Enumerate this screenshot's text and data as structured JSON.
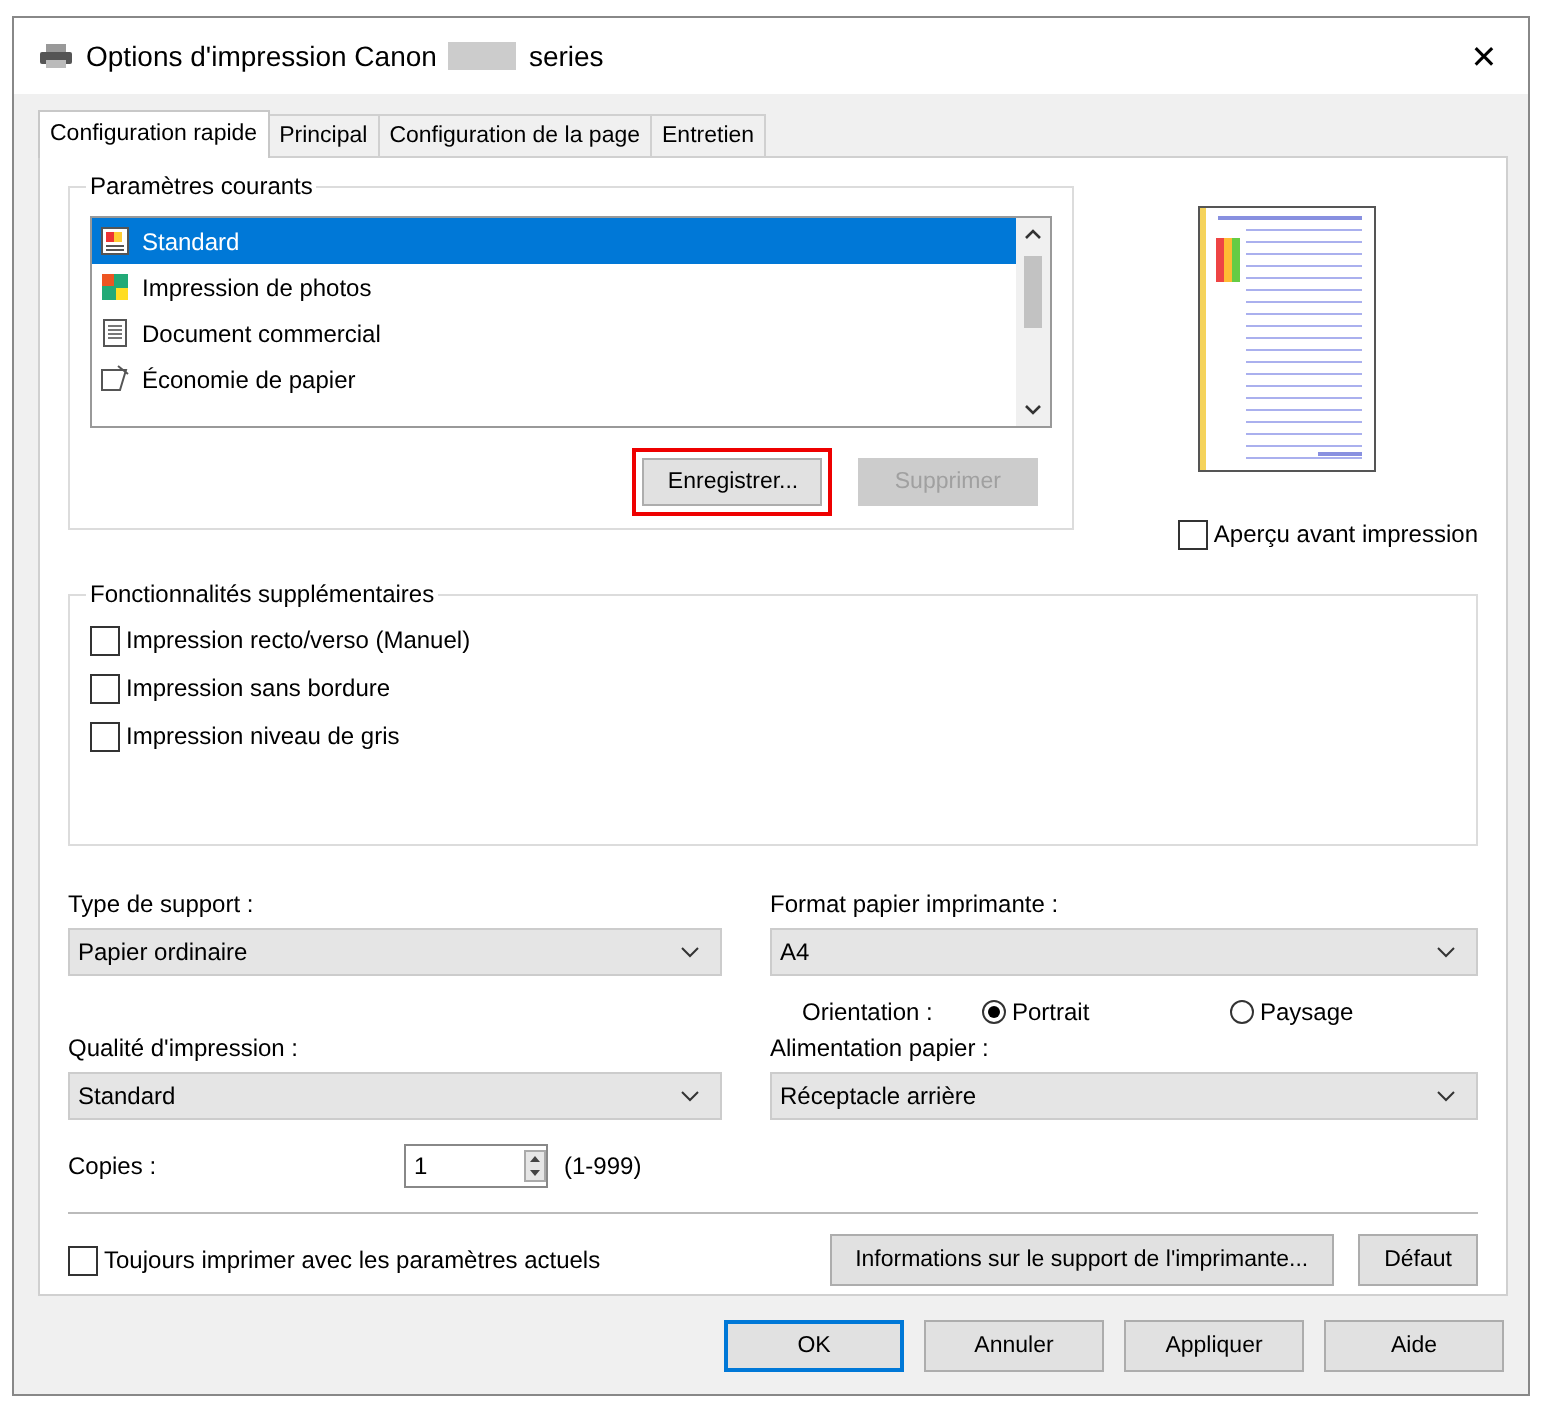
{
  "window": {
    "title": "Options d'impression Canon",
    "title_suffix": "series",
    "close": "✕"
  },
  "tabs": [
    {
      "label": "Configuration rapide",
      "selected": true
    },
    {
      "label": "Principal",
      "selected": false
    },
    {
      "label": "Configuration de la page",
      "selected": false
    },
    {
      "label": "Entretien",
      "selected": false
    }
  ],
  "current_settings": {
    "title": "Paramètres courants",
    "items": [
      {
        "label": "Standard",
        "selected": true,
        "kind": "standard"
      },
      {
        "label": "Impression de photos",
        "selected": false,
        "kind": "photo"
      },
      {
        "label": "Document commercial",
        "selected": false,
        "kind": "document"
      },
      {
        "label": "Économie de papier",
        "selected": false,
        "kind": "paper"
      }
    ],
    "buttons": [
      {
        "label": "Enregistrer...",
        "disabled": false,
        "highlighted": true
      },
      {
        "label": "Supprimer",
        "disabled": true,
        "highlighted": false
      }
    ]
  },
  "preview": {
    "checkbox": {
      "label": "Aperçu avant impression",
      "checked": false
    }
  },
  "additional_features": {
    "title": "Fonctionnalités supplémentaires",
    "options": [
      {
        "label": "Impression recto/verso (Manuel)",
        "checked": false
      },
      {
        "label": "Impression sans bordure",
        "checked": false
      },
      {
        "label": "Impression niveau de gris",
        "checked": false
      }
    ]
  },
  "media_type": {
    "label": "Type de support :",
    "value": "Papier ordinaire"
  },
  "page_size": {
    "label": "Format papier imprimante :",
    "value": "A4"
  },
  "orientation": {
    "label": "Orientation :",
    "options": [
      {
        "label": "Portrait",
        "selected": true
      },
      {
        "label": "Paysage",
        "selected": false
      }
    ]
  },
  "print_quality": {
    "label": "Qualité d'impression :",
    "value": "Standard"
  },
  "paper_source": {
    "label": "Alimentation papier :",
    "value": "Réceptacle arrière"
  },
  "copies": {
    "label": "Copies :",
    "value": "1",
    "range": "(1-999)"
  },
  "always_print": {
    "label": "Toujours imprimer avec les paramètres actuels",
    "checked": false
  },
  "panel_buttons": [
    "Informations sur le support de l'imprimante...",
    "Défaut"
  ],
  "dialog_buttons": [
    {
      "label": "OK",
      "default": true
    },
    {
      "label": "Annuler",
      "default": false
    },
    {
      "label": "Appliquer",
      "default": false
    },
    {
      "label": "Aide",
      "default": false
    }
  ]
}
